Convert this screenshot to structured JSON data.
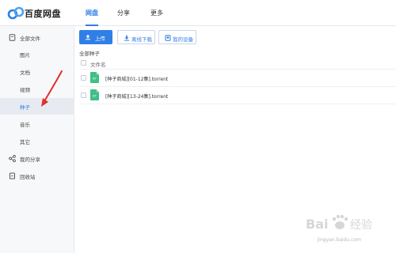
{
  "app": {
    "brand": "百度网盘",
    "nav": [
      {
        "label": "网盘",
        "active": true
      },
      {
        "label": "分享",
        "active": false
      },
      {
        "label": "更多",
        "active": false
      }
    ]
  },
  "sidebar": {
    "items": [
      {
        "label": "全部文件",
        "icon": "file-icon",
        "kind": "top"
      },
      {
        "label": "图片",
        "kind": "sub"
      },
      {
        "label": "文档",
        "kind": "sub"
      },
      {
        "label": "视频",
        "kind": "sub"
      },
      {
        "label": "种子",
        "kind": "sub",
        "active": true
      },
      {
        "label": "音乐",
        "kind": "sub"
      },
      {
        "label": "其它",
        "kind": "sub"
      },
      {
        "label": "我的分享",
        "icon": "share-icon",
        "kind": "top"
      },
      {
        "label": "回收站",
        "icon": "trash-icon",
        "kind": "top"
      }
    ]
  },
  "toolbar": {
    "upload_label": "上传",
    "offline_label": "离线下载",
    "devices_label": "我的设备"
  },
  "breadcrumb": "全部种子",
  "list": {
    "header": "文件名",
    "rows": [
      {
        "name": "[种子商城][01-12集].torrent",
        "icon_text": "BT"
      },
      {
        "name": "[种子商城][13-24集].torrent",
        "icon_text": "BT"
      }
    ]
  },
  "watermark": {
    "site": "jingyan.baidu.com",
    "logo_text": "Bai 经验"
  },
  "colors": {
    "accent": "#2f7fe7",
    "file_icon": "#3fbf86",
    "annotation": "#e0302c"
  }
}
